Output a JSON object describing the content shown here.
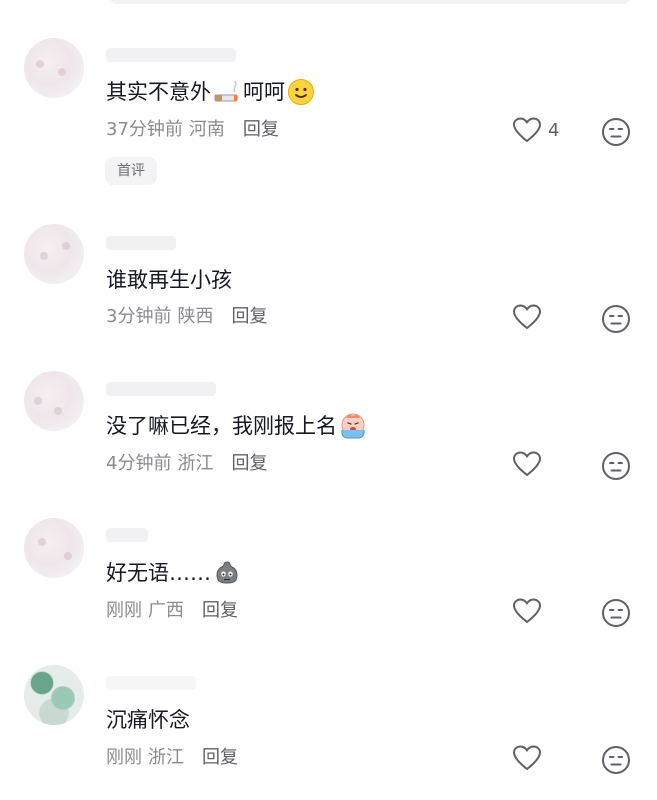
{
  "comments": [
    {
      "text": "其实不意外",
      "text_after": "呵呵",
      "emojis": [
        "cigarette-emoji",
        "smile-emoji"
      ],
      "time": "37分钟前",
      "location": "河南",
      "reply_label": "回复",
      "likes": "4",
      "badge": "首评"
    },
    {
      "text": "谁敢再生小孩",
      "time": "3分钟前",
      "location": "陕西",
      "reply_label": "回复"
    },
    {
      "text": "没了嘛已经，我刚报上名",
      "emojis": [
        "crying-emoji"
      ],
      "time": "4分钟前",
      "location": "浙江",
      "reply_label": "回复"
    },
    {
      "text": "好无语……",
      "emojis": [
        "speechless-emoji"
      ],
      "time": "刚刚",
      "location": "广西",
      "reply_label": "回复"
    },
    {
      "text": "沉痛怀念",
      "time": "刚刚",
      "location": "浙江",
      "reply_label": "回复"
    }
  ],
  "icons": {
    "like": "heart-icon",
    "dislike": "neutral-face-icon"
  },
  "colors": {
    "text": "#161823",
    "meta": "#8a8b91",
    "icon": "#5f6068"
  }
}
